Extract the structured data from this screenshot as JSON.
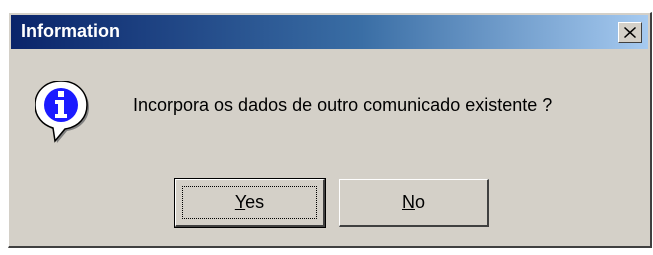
{
  "dialog": {
    "title": "Information",
    "message": "Incorpora os dados de outro comunicado existente ?",
    "icon": "info-icon",
    "buttons": {
      "yes_label": "Yes",
      "no_label": "No"
    },
    "colors": {
      "titlebar_start": "#0a246a",
      "titlebar_end": "#a6caf0",
      "face": "#d4d0c8"
    }
  }
}
